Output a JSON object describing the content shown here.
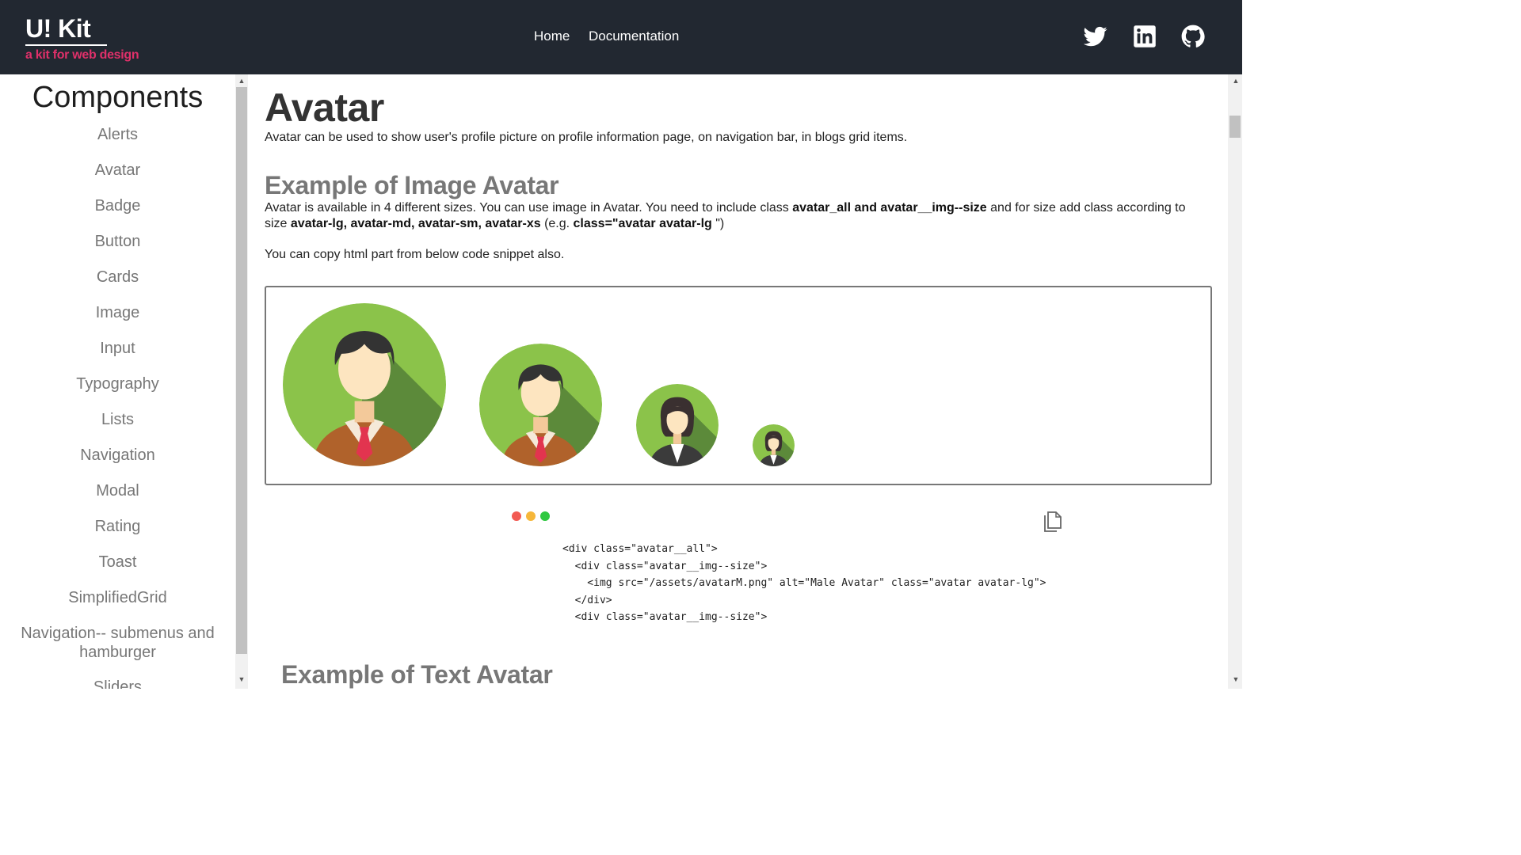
{
  "brand": {
    "title": "U! Kit",
    "subtitle": "a kit for web design"
  },
  "nav": {
    "home": "Home",
    "documentation": "Documentation"
  },
  "social": [
    "twitter-icon",
    "linkedin-icon",
    "github-icon"
  ],
  "colors": {
    "navbar": "#222831",
    "brand_accent": "#e0306a",
    "section_heading": "#777777",
    "avatar_green": "#8bc34a"
  },
  "sidebar": {
    "title": "Components",
    "items": [
      "Alerts",
      "Avatar",
      "Badge",
      "Button",
      "Cards",
      "Image",
      "Input",
      "Typography",
      "Lists",
      "Navigation",
      "Modal",
      "Rating",
      "Toast",
      "SimplifiedGrid",
      "Navigation-- submenus and",
      "hamburger",
      "Sliders"
    ]
  },
  "main": {
    "title": "Avatar",
    "intro": "Avatar can be used to show user's profile picture on profile information page, on navigation bar, in blogs grid items.",
    "section1": {
      "heading": "Example of Image Avatar",
      "desc_1": "Avatar is available in 4 different sizes. You can use image in Avatar. You need to include class ",
      "desc_bold_1": "avatar_all and avatar__img--size",
      "desc_2": " and for size add class according to size ",
      "desc_bold_2": "avatar-lg, avatar-md, avatar-sm, avatar-xs",
      "desc_3": " (e.g. ",
      "desc_bold_3": "class=\"avatar avatar-lg",
      "desc_4": " \")",
      "copy_note": "You can copy html part from below code snippet also.",
      "avatars": [
        "male-avatar-lg",
        "male-avatar-md",
        "female-avatar-sm",
        "female-avatar-xs"
      ]
    },
    "code_lines": [
      "<div class=\"avatar__all\">",
      "  <div class=\"avatar__img--size\">",
      "    <img src=\"/assets/avatarM.png\" alt=\"Male Avatar\" class=\"avatar avatar-lg\">",
      "  </div>",
      "  <div class=\"avatar__img--size\">"
    ],
    "section2": {
      "heading": "Example of Text Avatar"
    }
  }
}
